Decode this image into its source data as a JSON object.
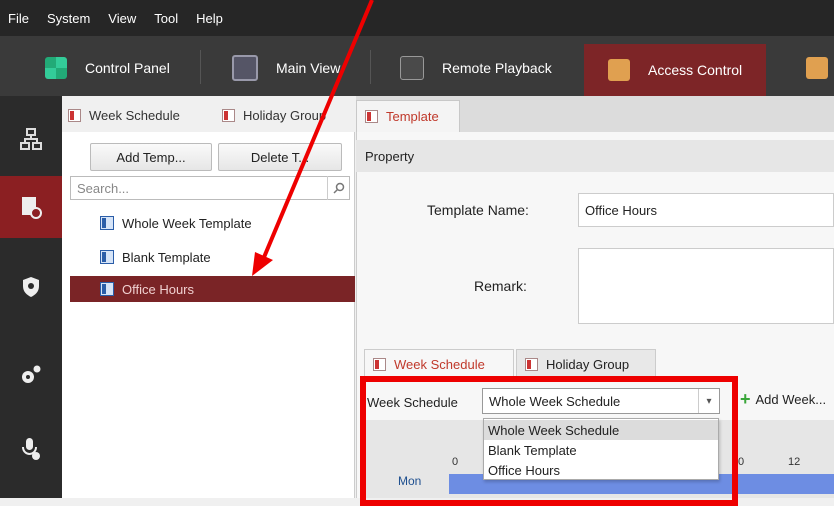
{
  "menu": [
    "File",
    "System",
    "View",
    "Tool",
    "Help"
  ],
  "modules": {
    "control_panel": "Control Panel",
    "main_view": "Main View",
    "remote_playback": "Remote Playback",
    "access_control": "Access Control"
  },
  "left_tabs": {
    "week_schedule": "Week Schedule",
    "holiday_group": "Holiday Group"
  },
  "left_panel": {
    "add_button": "Add Temp...",
    "delete_button": "Delete T...",
    "search_placeholder": "Search...",
    "templates": [
      "Whole Week Template",
      "Blank Template",
      "Office Hours"
    ]
  },
  "right": {
    "tab_template": "Template",
    "property_header": "Property",
    "template_name_label": "Template Name:",
    "template_name_value": "Office Hours",
    "remark_label": "Remark:",
    "remark_value": "",
    "sub_tab_week": "Week Schedule",
    "sub_tab_holiday": "Holiday Group",
    "week_schedule_label": "Week Schedule",
    "week_schedule_selected": "Whole Week Schedule",
    "add_week_label": "Add Week...",
    "dropdown_options": [
      "Whole Week Schedule",
      "Blank Template",
      "Office Hours"
    ],
    "day_label": "Mon",
    "ticks": [
      "0",
      "0",
      "12"
    ]
  },
  "colors": {
    "accent_red": "#7d2527",
    "annotation_red": "#ee0000",
    "schedule_bar": "#6d8de3"
  }
}
